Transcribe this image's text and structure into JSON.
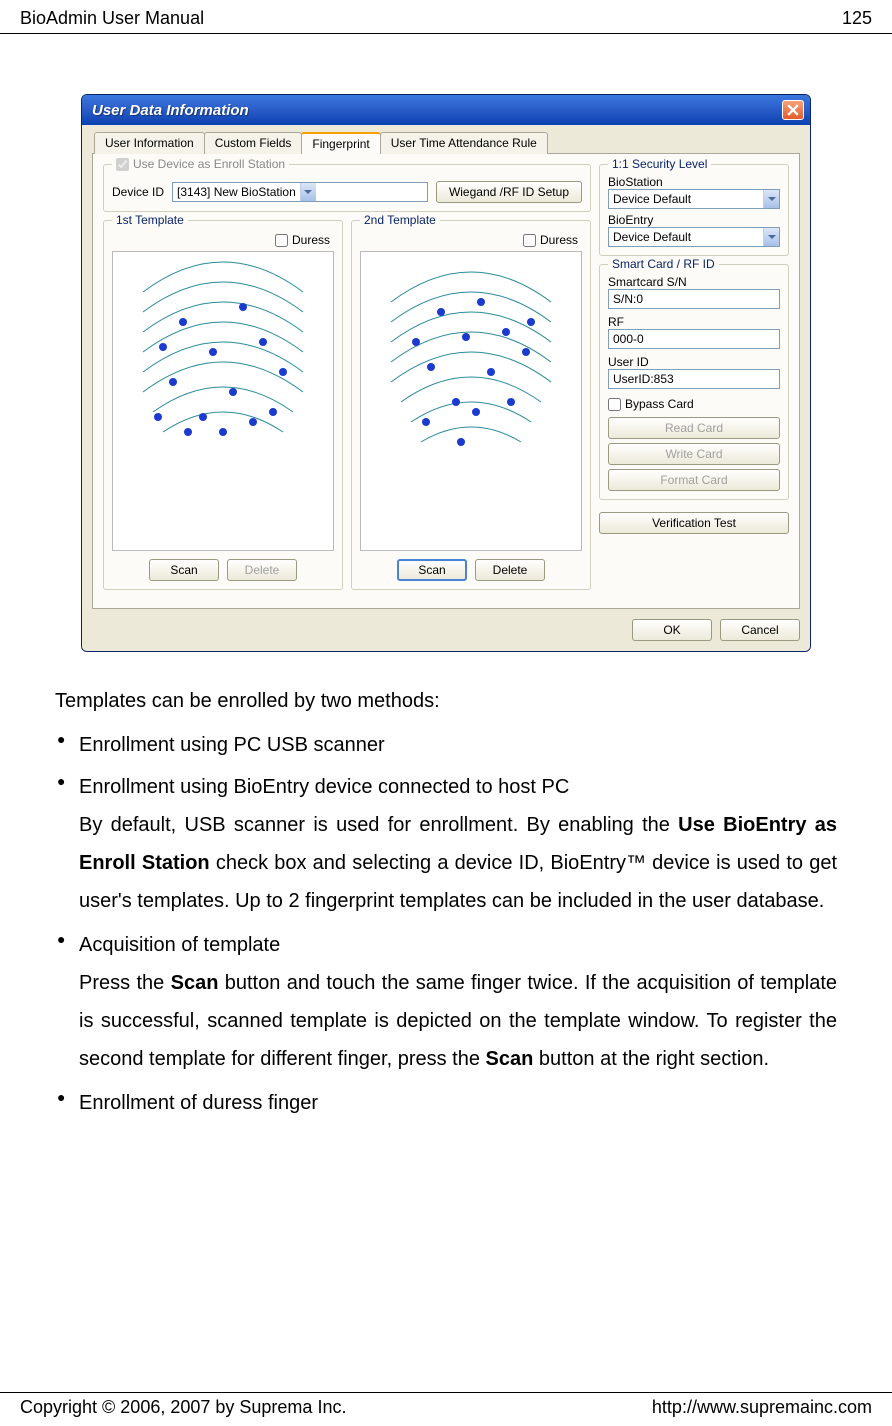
{
  "header": {
    "left": "BioAdmin User Manual",
    "right": "125"
  },
  "footer": {
    "left": "Copyright © 2006, 2007 by Suprema Inc.",
    "right": "http://www.supremainc.com"
  },
  "dialog": {
    "title": "User Data Information",
    "tabs": [
      "User Information",
      "Custom Fields",
      "Fingerprint",
      "User Time Attendance Rule"
    ],
    "active_tab": 2,
    "enroll_group": {
      "legend_checkbox": "Use Device as Enroll Station",
      "device_id_label": "Device ID",
      "device_id_value": "[3143] New BioStation",
      "wiegand_btn": "Wiegand /RF ID Setup"
    },
    "template1": {
      "legend": "1st Template",
      "duress": "Duress",
      "scan": "Scan",
      "delete": "Delete"
    },
    "template2": {
      "legend": "2nd Template",
      "duress": "Duress",
      "scan": "Scan",
      "delete": "Delete"
    },
    "security": {
      "legend": "1:1 Security Level",
      "biostation_label": "BioStation",
      "biostation_value": "Device Default",
      "bioentry_label": "BioEntry",
      "bioentry_value": "Device Default"
    },
    "smartcard": {
      "legend": "Smart Card / RF ID",
      "sn_label": "Smartcard S/N",
      "sn_value": "S/N:0",
      "rf_label": "RF",
      "rf_value": "000-0",
      "userid_label": "User ID",
      "userid_value": "UserID:853",
      "bypass": "Bypass Card",
      "read": "Read Card",
      "write": "Write Card",
      "format": "Format Card"
    },
    "verify_btn": "Verification Test",
    "ok": "OK",
    "cancel": "Cancel"
  },
  "text": {
    "intro": "Templates can be enrolled by two methods:",
    "b1": "Enrollment using PC USB scanner",
    "b2": "Enrollment using BioEntry device connected to host PC",
    "b2_p1a": "By default, USB scanner is used for enrollment. By enabling the ",
    "b2_bold": "Use BioEntry as Enroll Station",
    "b2_p1b": " check box and selecting a device ID, BioEntry™ device is used to get user's templates. Up to 2 fingerprint templates can be included in the user database.",
    "b3": "Acquisition of template",
    "b3_p1a": "Press the ",
    "b3_bold1": "Scan",
    "b3_p1b": " button and touch the same finger twice. If the acquisition of template is successful, scanned template is depicted on the template window. To register the second template for different finger, press the ",
    "b3_bold2": "Scan",
    "b3_p1c": " button at the right section.",
    "b4": "Enrollment of duress finger"
  }
}
